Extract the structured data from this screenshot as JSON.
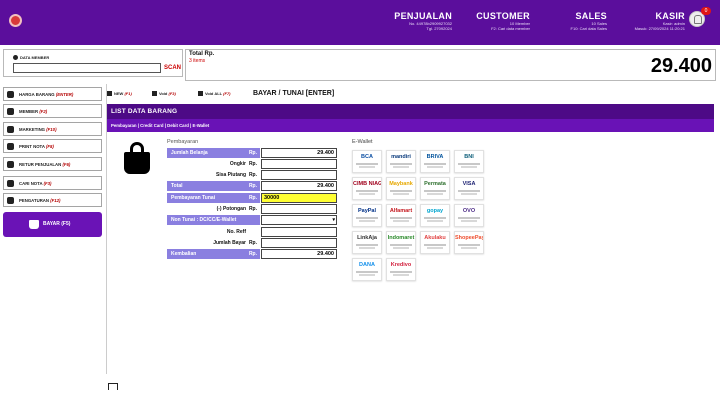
{
  "header": {
    "sections": [
      {
        "title": "PENJUALAN",
        "line1": "No. 44978b2909927032",
        "line2": "Tgl. 27092024"
      },
      {
        "title": "CUSTOMER",
        "line1": "10 Member",
        "line2": "F2: Cari data member"
      },
      {
        "title": "SALES",
        "line1": "10 Sales",
        "line2": "F10: Cari data Sales"
      },
      {
        "title": "KASIR",
        "line1": "Kasir: admin",
        "line2": "Masuk: 27/09/2024 11:20:21"
      }
    ],
    "notif_count": "0"
  },
  "member": {
    "label": "DATA MEMBER",
    "input_value": "",
    "scan_label": "SCAN"
  },
  "total": {
    "label": "Total Rp.",
    "items": "3 items",
    "value": "29.400"
  },
  "sidebar": {
    "items": [
      {
        "label": "HARGA BARANG",
        "key": "(ENTER)",
        "icon": "tag-icon"
      },
      {
        "label": "MEMBER",
        "key": "(F2)",
        "icon": "user-icon"
      },
      {
        "label": "MARKETING",
        "key": "(F10)",
        "icon": "users-icon"
      },
      {
        "label": "PRINT NOTA",
        "key": "(F8)",
        "icon": "printer-icon"
      },
      {
        "label": "RETUR PENJUALAN",
        "key": "(F6)",
        "icon": "return-icon"
      },
      {
        "label": "CARI NOTA",
        "key": "(F3)",
        "icon": "search-icon"
      },
      {
        "label": "PENGATURAN",
        "key": "(F12)",
        "icon": "gear-icon"
      }
    ],
    "bayar_label": "BAYAR (F5)"
  },
  "toolbar": {
    "new_label": "NEW",
    "new_key": "(F1)",
    "void_label": "Void",
    "void_key": "(F3)",
    "void_all_label": "Void ALL",
    "void_all_key": "(F7)",
    "pay_label": "BAYAR / TUNAI [ENTER]"
  },
  "list": {
    "title": "LIST DATA BARANG",
    "tabs": "Pembayaran | Credit Card | Debit Card | E-Wallet"
  },
  "payment": {
    "title": "Pembayaran",
    "currency": "Rp.",
    "rows": [
      {
        "label": "Jumlah Belanja",
        "value": "29.400"
      },
      {
        "label": "Ongkir",
        "value": ""
      },
      {
        "label": "Sisa Piutang",
        "value": ""
      },
      {
        "label": "Total",
        "value": "29.400"
      },
      {
        "label": "Pembayaran Tunai",
        "value": "30000"
      },
      {
        "label": "(-) Potongan",
        "value": ""
      },
      {
        "label": "Non Tunai : DC/CC/E-Wallet",
        "value": ""
      },
      {
        "label": "No. Reff",
        "value": ""
      },
      {
        "label": "Jumlah Bayar",
        "value": ""
      },
      {
        "label": "Kembalian",
        "value": "29.400"
      }
    ]
  },
  "ewallet": {
    "title": "E-Wallet",
    "items": [
      {
        "name": "BCA",
        "color": "#0b4ea2"
      },
      {
        "name": "mandiri",
        "color": "#0a3a7c"
      },
      {
        "name": "BRIVA",
        "color": "#00529c"
      },
      {
        "name": "BNI",
        "color": "#0a5c78"
      },
      {
        "name": "CIMB NIAGA",
        "color": "#a0001c"
      },
      {
        "name": "Maybank",
        "color": "#e6a800"
      },
      {
        "name": "Permata",
        "color": "#2c6e2c"
      },
      {
        "name": "VISA",
        "color": "#1a1f71"
      },
      {
        "name": "PayPal",
        "color": "#003087"
      },
      {
        "name": "Alfamart",
        "color": "#c4161c"
      },
      {
        "name": "gopay",
        "color": "#00a5cf"
      },
      {
        "name": "OVO",
        "color": "#4c2a86"
      },
      {
        "name": "LinkAja",
        "color": "#333333"
      },
      {
        "name": "Indomaret",
        "color": "#2a8a2a"
      },
      {
        "name": "Akulaku",
        "color": "#e04040"
      },
      {
        "name": "ShopeePay",
        "color": "#ee4d2d"
      },
      {
        "name": "DANA",
        "color": "#118eea"
      },
      {
        "name": "Kredivo",
        "color": "#d21f3c"
      }
    ]
  }
}
